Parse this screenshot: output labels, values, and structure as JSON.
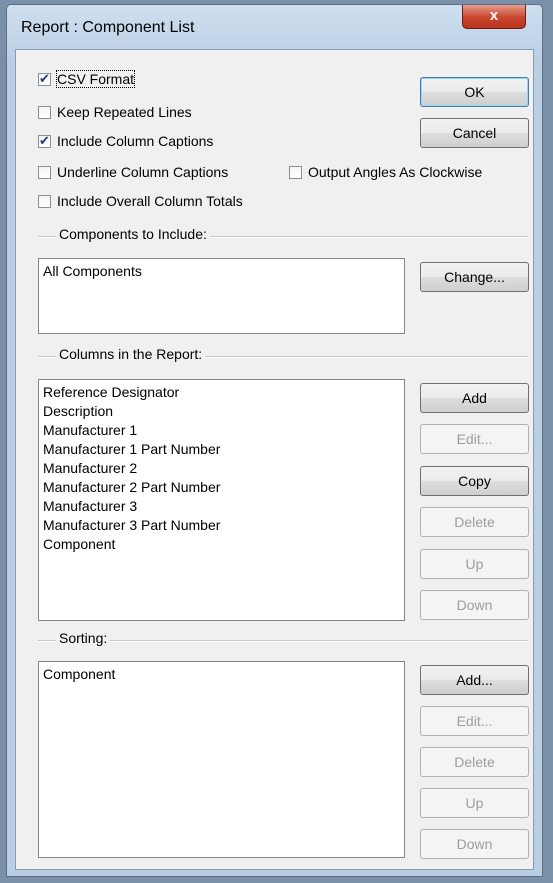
{
  "window": {
    "title": "Report : Component List",
    "close_glyph": "x"
  },
  "options": {
    "csv_format": {
      "label": "CSV Format",
      "checked": true
    },
    "keep_repeated_lines": {
      "label": "Keep Repeated Lines",
      "checked": false
    },
    "include_column_captions": {
      "label": "Include Column Captions",
      "checked": true
    },
    "underline_column_captions": {
      "label": "Underline Column Captions",
      "checked": false
    },
    "output_angles_clockwise": {
      "label": "Output Angles As Clockwise",
      "checked": false
    },
    "include_overall_column_totals": {
      "label": "Include Overall Column Totals",
      "checked": false
    }
  },
  "buttons": {
    "ok": "OK",
    "cancel": "Cancel",
    "change": "Change..."
  },
  "components": {
    "heading": "Components to Include:",
    "items": [
      "All Components"
    ]
  },
  "columns": {
    "heading": "Columns in the Report:",
    "items": [
      "Reference Designator",
      "Description",
      "Manufacturer 1",
      "Manufacturer 1 Part Number",
      "Manufacturer 2",
      "Manufacturer 2 Part Number",
      "Manufacturer 3",
      "Manufacturer 3 Part Number",
      "Component"
    ],
    "buttons": {
      "add": "Add",
      "edit": "Edit...",
      "copy": "Copy",
      "delete": "Delete",
      "up": "Up",
      "down": "Down"
    }
  },
  "sorting": {
    "heading": "Sorting:",
    "items": [
      "Component"
    ],
    "buttons": {
      "add": "Add...",
      "edit": "Edit...",
      "delete": "Delete",
      "up": "Up",
      "down": "Down"
    }
  }
}
